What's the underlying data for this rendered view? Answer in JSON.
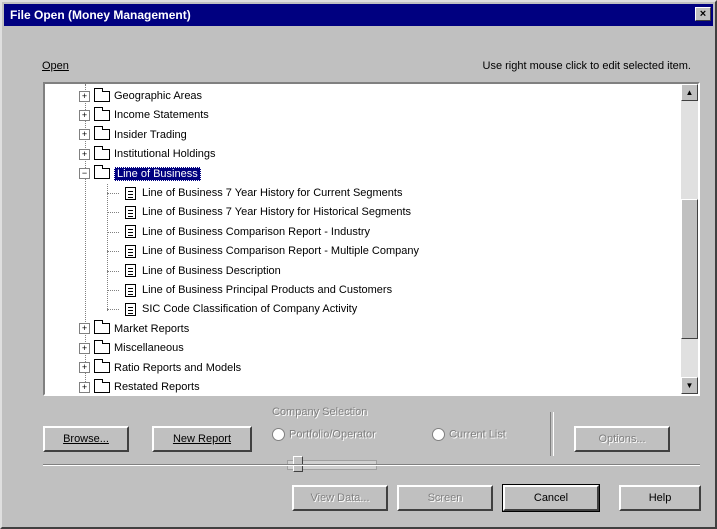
{
  "window": {
    "title": "File Open   (Money Management)",
    "close_label": "×"
  },
  "open_label": "Open",
  "hint": "Use right mouse click to edit selected item.",
  "tree": {
    "folders_before": [
      {
        "label": "Geographic Areas",
        "expander": "+"
      },
      {
        "label": "Income Statements",
        "expander": "+"
      },
      {
        "label": "Insider Trading",
        "expander": "+"
      },
      {
        "label": "Institutional Holdings",
        "expander": "+"
      }
    ],
    "expanded_folder": {
      "label": "Line of Business",
      "expander": "−"
    },
    "reports": [
      "Line of Business 7 Year History for Current Segments",
      "Line of Business 7 Year History for Historical Segments",
      "Line of Business Comparison Report - Industry",
      "Line of Business Comparison Report - Multiple Company",
      "Line of Business Description",
      "Line of Business Principal Products and Customers",
      "SIC Code Classification of Company Activity"
    ],
    "folders_after": [
      {
        "label": "Market Reports",
        "expander": "+"
      },
      {
        "label": "Miscellaneous",
        "expander": "+"
      },
      {
        "label": "Ratio Reports and Models",
        "expander": "+"
      },
      {
        "label": "Restated Reports",
        "expander": "+"
      }
    ]
  },
  "scroll": {
    "up": "▲",
    "down": "▼"
  },
  "buttons": {
    "browse": "Browse...",
    "new_report": "New Report",
    "options": "Options...",
    "view_data": "View Data...",
    "screen": "Screen",
    "cancel": "Cancel",
    "help": "Help"
  },
  "radio": {
    "group_label": "Company Selection",
    "option1": "Portfolio/Operator",
    "option2": "Current List"
  }
}
